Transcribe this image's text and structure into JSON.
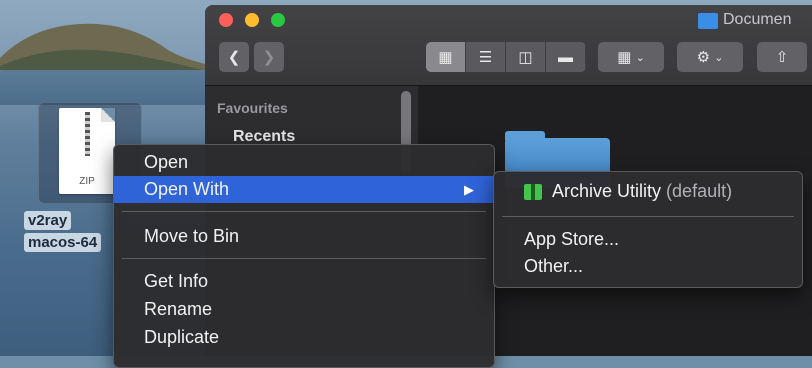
{
  "desktop": {
    "file_name_line1": "v2ray",
    "file_name_line2": "macos-64",
    "zip_badge": "ZIP"
  },
  "finder": {
    "title": "Documen",
    "nav": {
      "back_icon": "chevron-left-icon",
      "forward_icon": "chevron-right-icon"
    },
    "view_modes": [
      "icon-view-icon",
      "list-view-icon",
      "column-view-icon",
      "gallery-view-icon"
    ],
    "active_view": "icon-view-icon",
    "sidebar": {
      "section_title": "Favourites",
      "items": [
        "Recents"
      ]
    }
  },
  "context_menu": {
    "items": [
      {
        "label": "Open"
      },
      {
        "label": "Open With",
        "highlighted": true,
        "submenu_arrow": "▶"
      },
      {
        "label": "Move to Bin"
      },
      {
        "label": "Get Info"
      },
      {
        "label": "Rename"
      },
      {
        "label": "Duplicate"
      }
    ]
  },
  "submenu": {
    "default_app": "Archive Utility",
    "default_tag": "(default)",
    "items": [
      "App Store...",
      "Other..."
    ]
  },
  "colors": {
    "highlight": "#2f63d8",
    "menu_bg": "#2c2c30"
  }
}
